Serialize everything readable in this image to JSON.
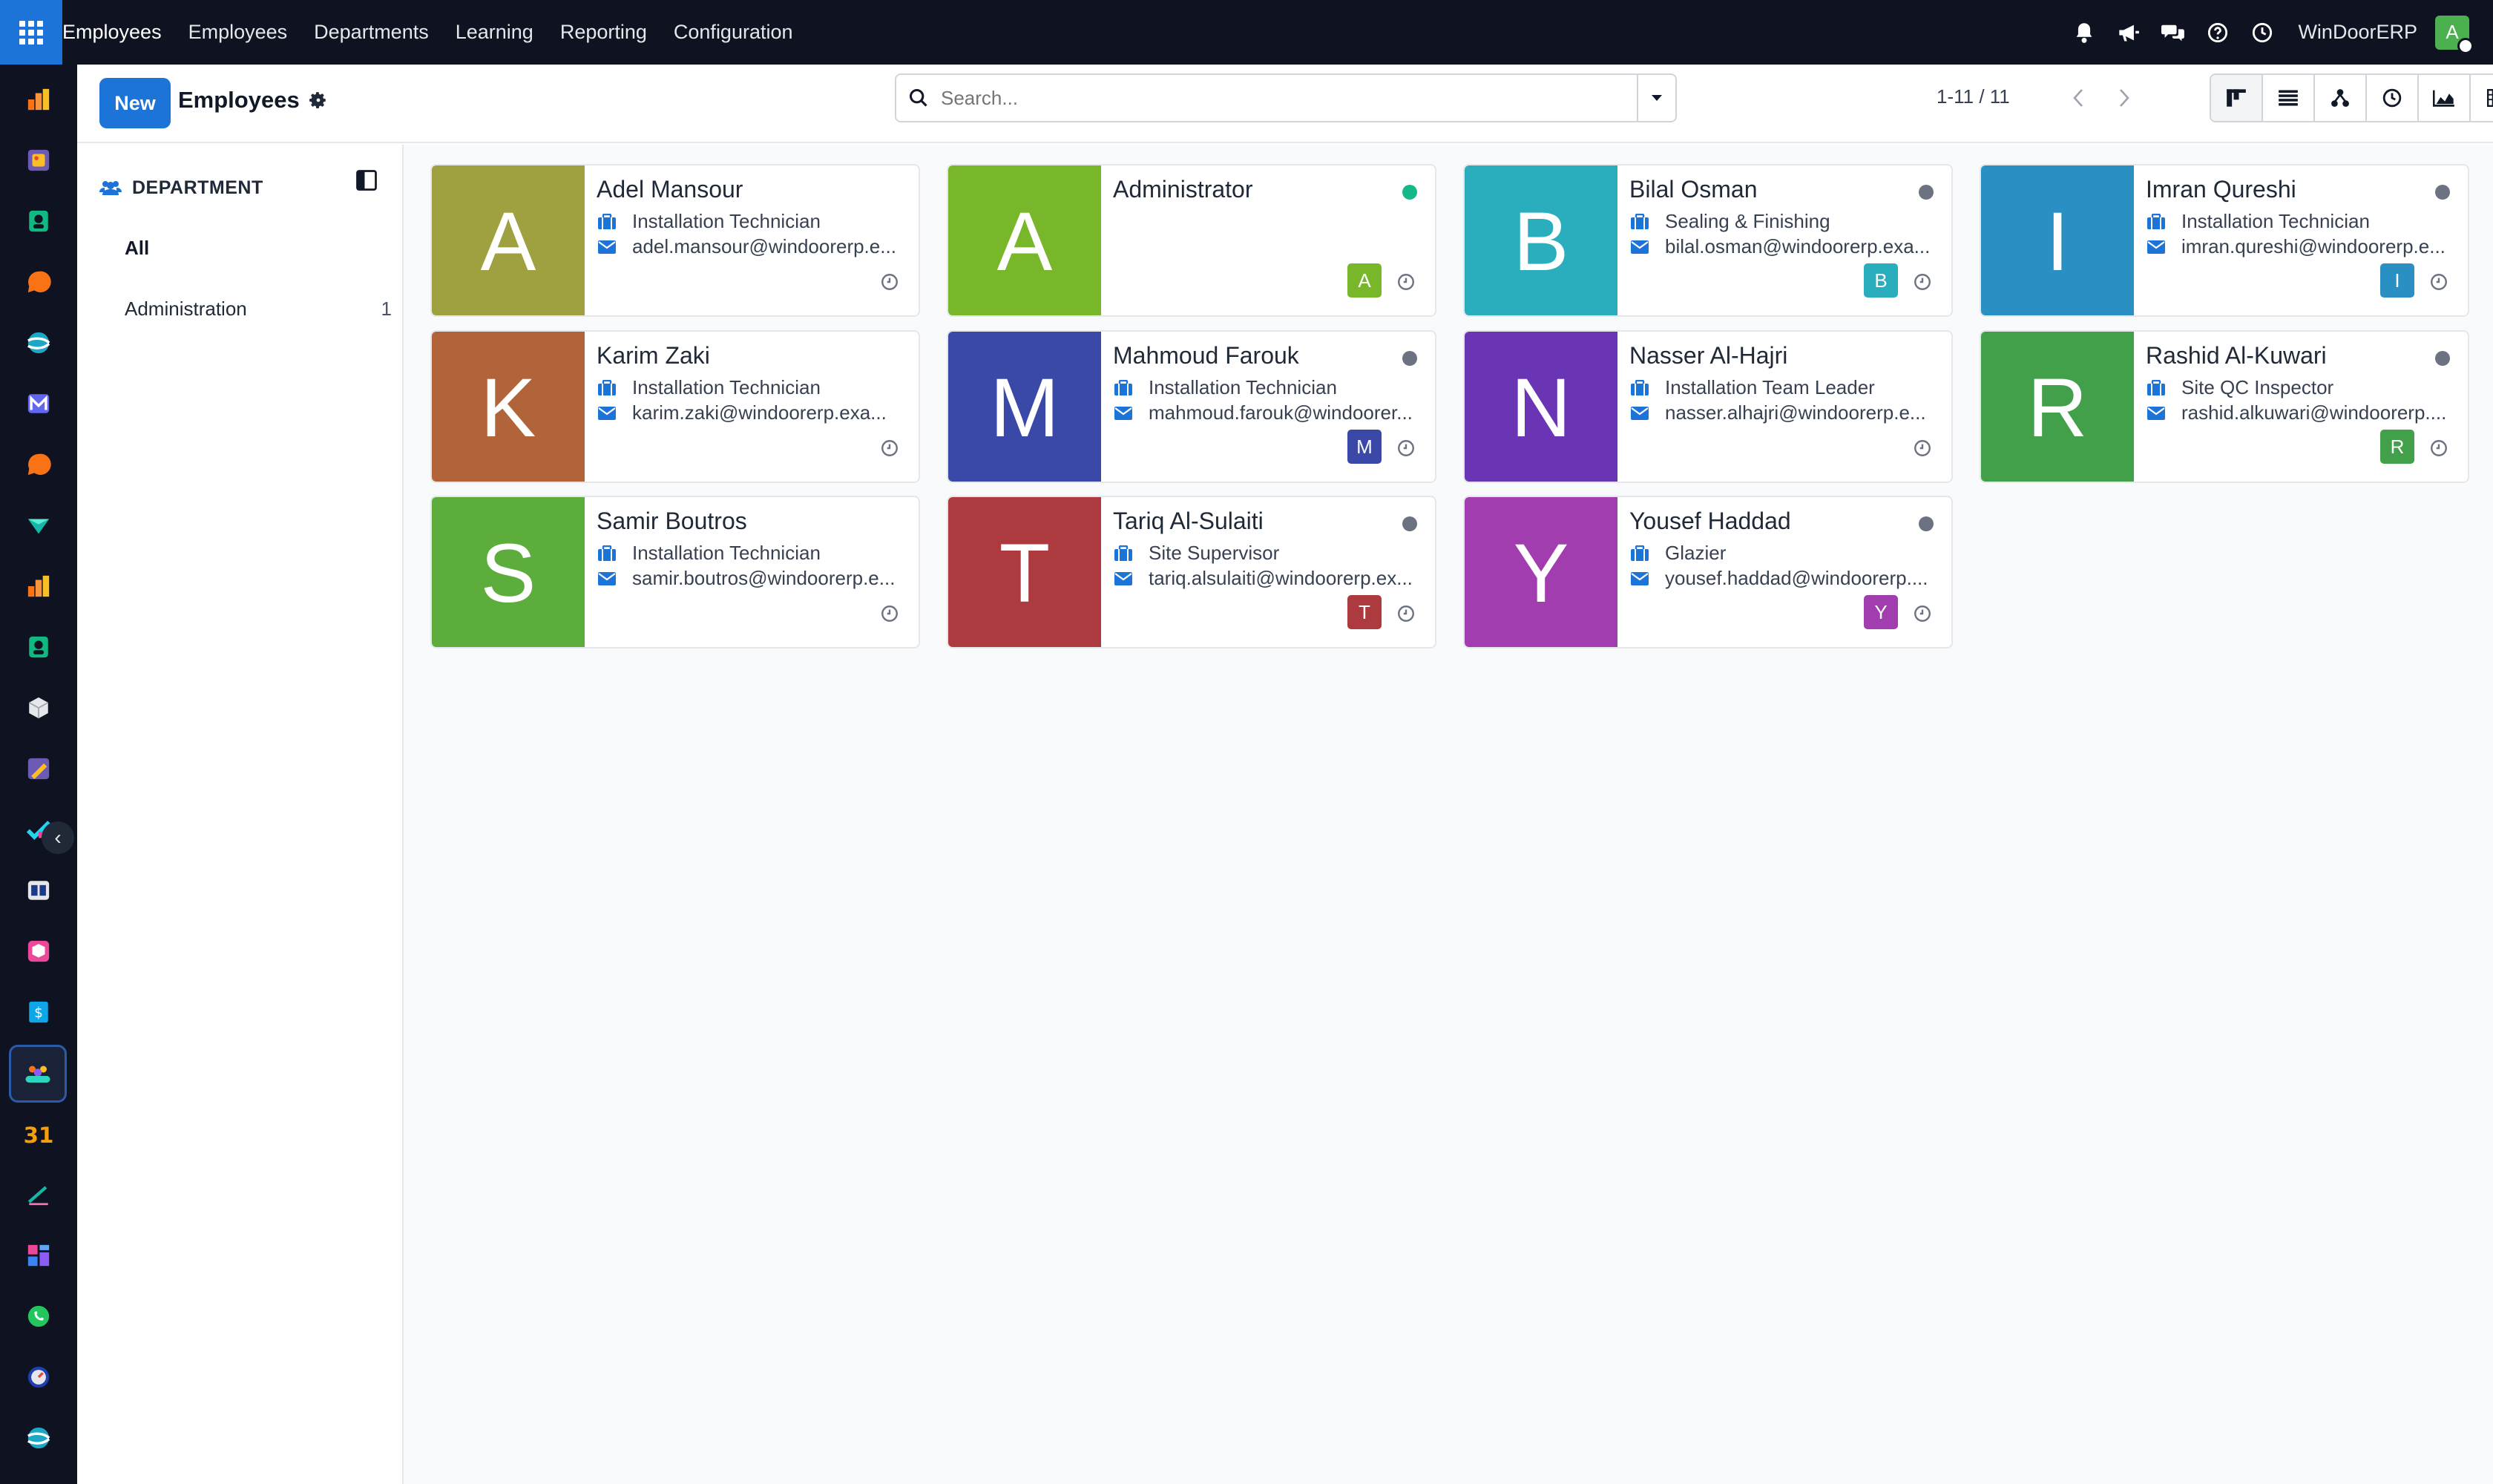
{
  "topbar": {
    "brand": "Employees",
    "menu": [
      "Employees",
      "Departments",
      "Learning",
      "Reporting",
      "Configuration"
    ],
    "company": "WinDoorERP",
    "user_initial": "A"
  },
  "control": {
    "new_label": "New",
    "title": "Employees",
    "search_placeholder": "Search...",
    "pager": "1-11 / 11"
  },
  "sidepanel": {
    "title": "DEPARTMENT",
    "items": [
      {
        "label": "All",
        "count": ""
      },
      {
        "label": "Administration",
        "count": "1"
      }
    ]
  },
  "employees": [
    {
      "name": "Adel Mansour",
      "initial": "A",
      "color": "#9fa040",
      "job": "Installation Technician",
      "email": "adel.mansour@windoorerp.e...",
      "status": "offline",
      "badge": ""
    },
    {
      "name": "Administrator",
      "initial": "A",
      "color": "#78b62a",
      "job": "",
      "email": "",
      "status": "online",
      "badge": "A"
    },
    {
      "name": "Bilal Osman",
      "initial": "B",
      "color": "#2aaebe",
      "job": "Sealing & Finishing",
      "email": "bilal.osman@windoorerp.exa...",
      "status": "away",
      "badge": "B"
    },
    {
      "name": "Imran Qureshi",
      "initial": "I",
      "color": "#2a8fc2",
      "job": "Installation Technician",
      "email": "imran.qureshi@windoorerp.e...",
      "status": "away",
      "badge": "I"
    },
    {
      "name": "Karim Zaki",
      "initial": "K",
      "color": "#b1633a",
      "job": "Installation Technician",
      "email": "karim.zaki@windoorerp.exa...",
      "status": "offline",
      "badge": ""
    },
    {
      "name": "Mahmoud Farouk",
      "initial": "M",
      "color": "#3a48a8",
      "job": "Installation Technician",
      "email": "mahmoud.farouk@windoorer...",
      "status": "away",
      "badge": "M"
    },
    {
      "name": "Nasser Al-Hajri",
      "initial": "N",
      "color": "#6a35b5",
      "job": "Installation Team Leader",
      "email": "nasser.alhajri@windoorerp.e...",
      "status": "offline",
      "badge": ""
    },
    {
      "name": "Rashid Al-Kuwari",
      "initial": "R",
      "color": "#43a04a",
      "job": "Site QC Inspector",
      "email": "rashid.alkuwari@windoorerp....",
      "status": "away",
      "badge": "R"
    },
    {
      "name": "Samir Boutros",
      "initial": "S",
      "color": "#5cad3c",
      "job": "Installation Technician",
      "email": "samir.boutros@windoorerp.e...",
      "status": "offline",
      "badge": ""
    },
    {
      "name": "Tariq Al-Sulaiti",
      "initial": "T",
      "color": "#ad3a3e",
      "job": "Site Supervisor",
      "email": "tariq.alsulaiti@windoorerp.ex...",
      "status": "away",
      "badge": "T"
    },
    {
      "name": "Yousef Haddad",
      "initial": "Y",
      "color": "#a23db0",
      "job": "Glazier",
      "email": "yousef.haddad@windoorerp....",
      "status": "away",
      "badge": "Y"
    }
  ],
  "icons": {
    "job": "briefcase-icon",
    "email": "envelope-icon",
    "activity": "clock-icon"
  }
}
